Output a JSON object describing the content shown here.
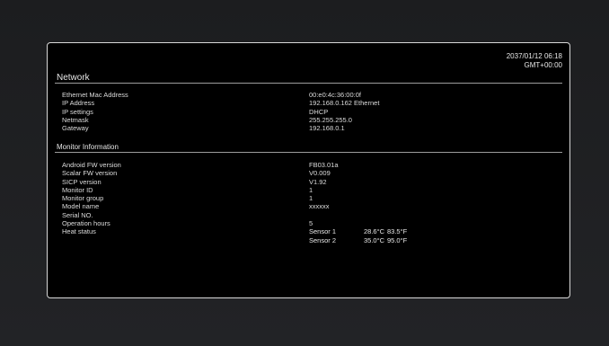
{
  "header": {
    "date_time": "2037/01/12 06:18",
    "timezone": "GMT+00:00"
  },
  "network": {
    "title": "Network",
    "rows": [
      {
        "label": "Ethernet Mac Address",
        "value": "00:e0:4c:36:00:0f"
      },
      {
        "label": "IP Address",
        "value": "192.168.0.162 Ethernet"
      },
      {
        "label": "IP settings",
        "value": "DHCP"
      },
      {
        "label": "Netmask",
        "value": "255.255.255.0"
      },
      {
        "label": "Gateway",
        "value": "192.168.0.1"
      }
    ]
  },
  "monitor": {
    "title": "Monitor Information",
    "rows": [
      {
        "label": "Android FW version",
        "value": "FB03.01a"
      },
      {
        "label": "Scalar FW version",
        "value": "V0.009"
      },
      {
        "label": "SICP version",
        "value": "V1.92"
      },
      {
        "label": "Monitor ID",
        "value": "1"
      },
      {
        "label": "Monitor group",
        "value": "1"
      },
      {
        "label": "Model name",
        "value": "xxxxxx"
      },
      {
        "label": "Serial NO.",
        "value": ""
      },
      {
        "label": "Operation hours",
        "value": "5"
      }
    ],
    "heat_status": {
      "label": "Heat status",
      "sensors": [
        {
          "name": "Sensor 1",
          "celsius": "28.6°C",
          "fahrenheit": "83.5°F"
        },
        {
          "name": "Sensor 2",
          "celsius": "35.0°C",
          "fahrenheit": "95.0°F"
        }
      ]
    }
  },
  "colors": {
    "background": "#202124",
    "panel": "#000000",
    "border": "#d8d8d8",
    "text": "#dcdcdc"
  }
}
